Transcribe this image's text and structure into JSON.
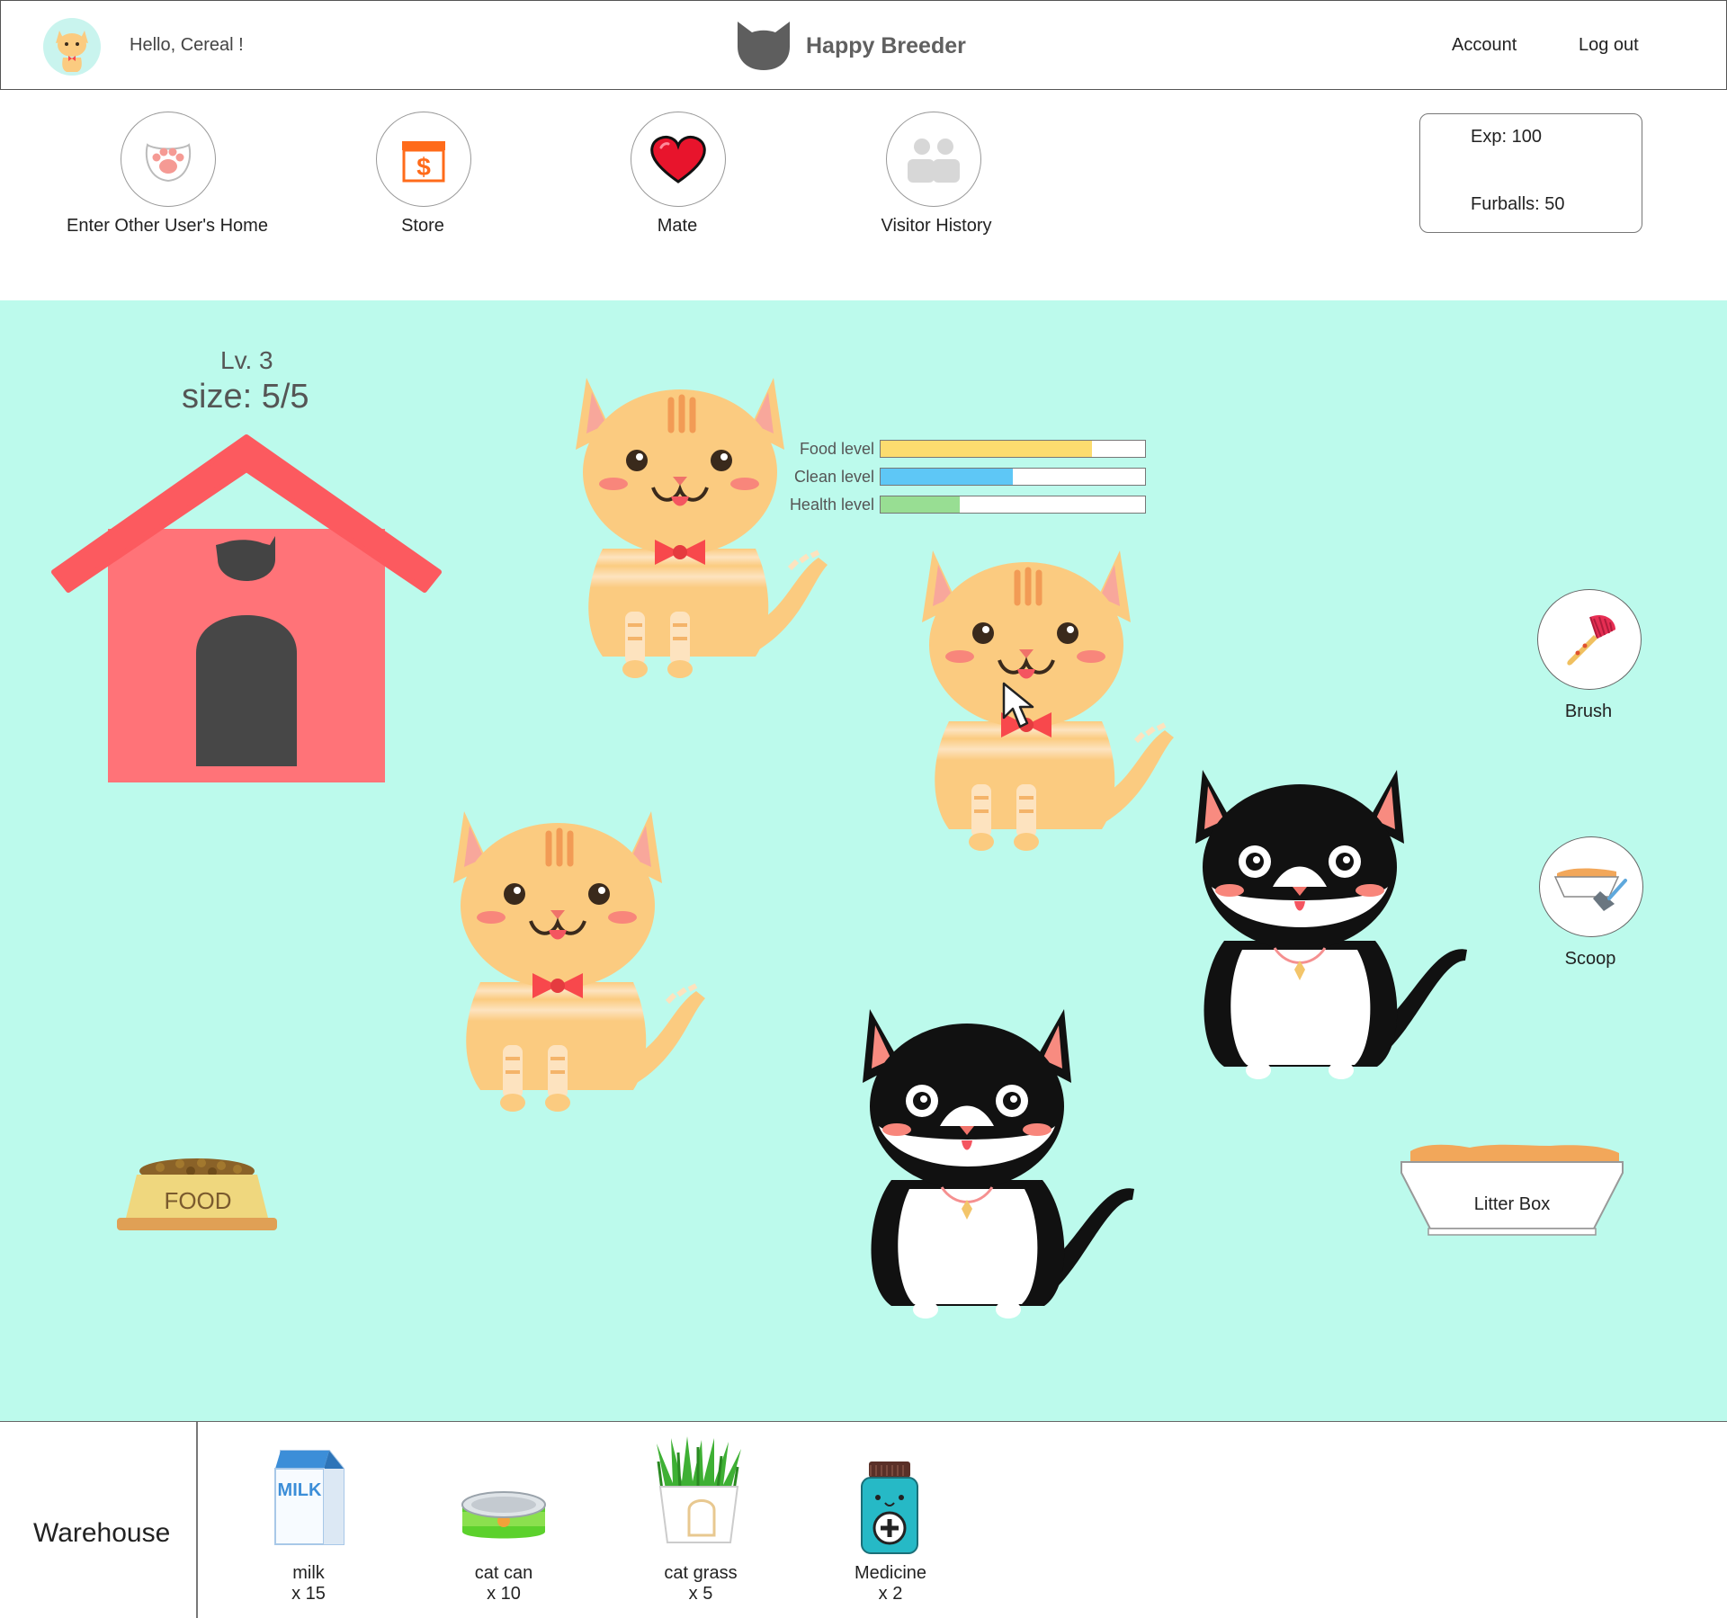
{
  "header": {
    "greeting": "Hello, Cereal !",
    "brand": "Happy Breeder",
    "account_label": "Account",
    "logout_label": "Log out"
  },
  "nav": {
    "items": [
      {
        "label": "Enter Other User's Home",
        "icon": "paw-icon"
      },
      {
        "label": "Store",
        "icon": "store-icon"
      },
      {
        "label": "Mate",
        "icon": "heart-icon"
      },
      {
        "label": "Visitor History",
        "icon": "visitors-icon"
      }
    ]
  },
  "stats": {
    "exp": "Exp: 100",
    "furballs": "Furballs: 50"
  },
  "room": {
    "level": "Lv. 3",
    "size": "size: 5/5",
    "status": [
      {
        "label": "Food level",
        "value": 0.8,
        "color": "#fcdc6f"
      },
      {
        "label": "Clean level",
        "value": 0.5,
        "color": "#5ec7f6"
      },
      {
        "label": "Health level",
        "value": 0.3,
        "color": "#98de93"
      }
    ],
    "food_bowl_text": "FOOD",
    "litter_box_label": "Litter Box",
    "tools": [
      {
        "label": "Brush",
        "icon": "brush-icon"
      },
      {
        "label": "Scoop",
        "icon": "scoop-icon"
      }
    ]
  },
  "warehouse": {
    "title": "Warehouse",
    "items": [
      {
        "name": "milk",
        "qty": "x 15",
        "icon": "milk-icon"
      },
      {
        "name": "cat can",
        "qty": "x 10",
        "icon": "cat-can-icon"
      },
      {
        "name": "cat grass",
        "qty": "x 5",
        "icon": "cat-grass-icon"
      },
      {
        "name": "Medicine",
        "qty": "x 2",
        "icon": "medicine-icon"
      }
    ]
  },
  "colors": {
    "room_background": "#bcfaec",
    "house_roof": "#fc5a5f",
    "house_wall": "#ff7378",
    "ginger_cat": "#fbcb80",
    "tuxedo_cat": "#111111"
  }
}
